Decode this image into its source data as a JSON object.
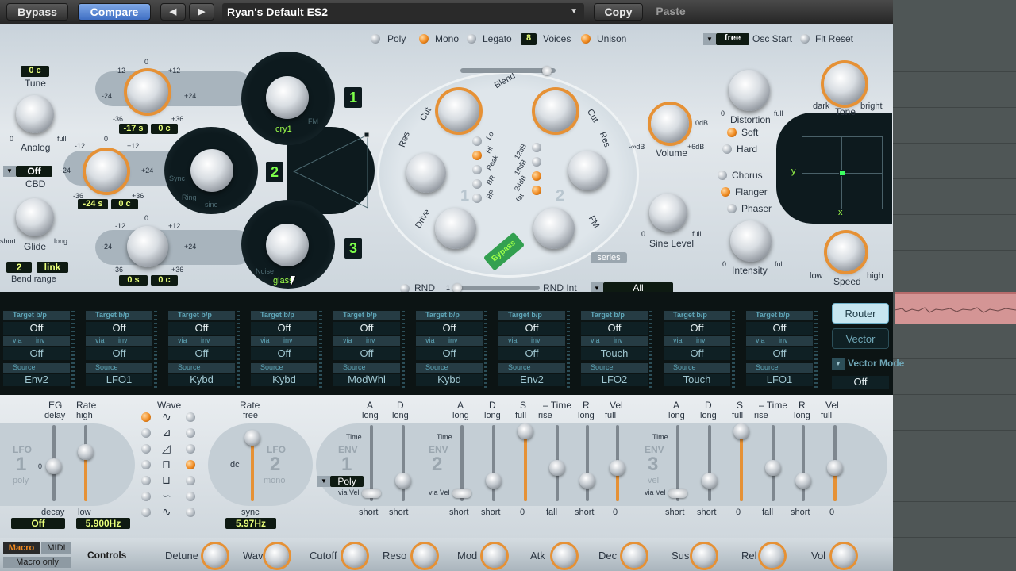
{
  "toolbar": {
    "bypass": "Bypass",
    "compare": "Compare",
    "prev": "◀",
    "next": "▶",
    "preset": "Ryan's Default ES2",
    "copy": "Copy",
    "paste": "Paste"
  },
  "voice": {
    "poly": "Poly",
    "mono": "Mono",
    "legato": "Legato",
    "voices": "8",
    "voices_label": "Voices",
    "unison": "Unison"
  },
  "osc_start": {
    "value": "free",
    "label": "Osc Start",
    "flt_reset": "Flt Reset"
  },
  "left": {
    "tune_value": "0 c",
    "tune": "Tune",
    "analog": "Analog",
    "full": "full",
    "zero": "0",
    "cbd_value": "Off",
    "cbd": "CBD",
    "glide": "Glide",
    "short": "short",
    "long": "long",
    "bend_value": "2",
    "bend_link": "link",
    "bend": "Bend range"
  },
  "osc": {
    "o1_plus": "+12",
    "o1_minus": "-12",
    "o1_p24": "+24",
    "o1_m24": "-24",
    "o1_p36": "+36",
    "o1_m36": "-36",
    "o1_zero": "0",
    "o1_lcd_a": "-17 s",
    "o1_lcd_b": "0 c",
    "o1_wave": "cry1",
    "o1_num": "1",
    "o1_fm": "FM",
    "o2_lcd_a": "-24 s",
    "o2_lcd_b": "0 c",
    "o2_wave": "sine",
    "o2_num": "2",
    "o2_sync": "Sync",
    "o2_ring": "Ring",
    "o3_lcd_a": "0 s",
    "o3_lcd_b": "0 c",
    "o3_wave": "glass",
    "o3_num": "3",
    "o3_noise": "Noise"
  },
  "filter": {
    "blend": "Blend",
    "cut1": "Cut",
    "res1": "Res",
    "drive": "Drive",
    "lo": "Lo",
    "hi": "Hi",
    "peak": "Peak",
    "br": "BR",
    "bp": "BP",
    "db12": "12dB",
    "db18": "18dB",
    "db24": "24dB",
    "fat": "fat",
    "cut2": "Cut",
    "res2": "Res",
    "fm": "FM",
    "series": "series",
    "bypass": "Bypass",
    "n1": "1",
    "n2": "2"
  },
  "rnd": {
    "label": "RND",
    "one": "1",
    "int": "RND Int",
    "value": "All"
  },
  "out": {
    "volume": "Volume",
    "minus_db": "-∞dB",
    "zero_db": "0dB",
    "plus6": "+6dB",
    "distortion": "Distortion",
    "soft": "Soft",
    "hard": "Hard",
    "tone": "Tone",
    "dark": "dark",
    "bright": "bright",
    "sine_level": "Sine Level",
    "full": "full",
    "chorus": "Chorus",
    "flanger": "Flanger",
    "phaser": "Phaser",
    "intensity": "Intensity",
    "speed": "Speed",
    "low": "low",
    "high": "high",
    "zero": "0",
    "x": "x",
    "y": "y"
  },
  "router": {
    "slots": [
      {
        "target": "Target",
        "bp": "b/p",
        "tval": "Off",
        "via": "via",
        "inv": "inv",
        "vval": "Off",
        "source": "Source",
        "sval": "Env2"
      },
      {
        "target": "Target",
        "bp": "b/p",
        "tval": "Off",
        "via": "via",
        "inv": "inv",
        "vval": "Off",
        "source": "Source",
        "sval": "LFO1"
      },
      {
        "target": "Target",
        "bp": "b/p",
        "tval": "Off",
        "via": "via",
        "inv": "inv",
        "vval": "Off",
        "source": "Source",
        "sval": "Kybd"
      },
      {
        "target": "Target",
        "bp": "b/p",
        "tval": "Off",
        "via": "via",
        "inv": "inv",
        "vval": "Off",
        "source": "Source",
        "sval": "Kybd"
      },
      {
        "target": "Target",
        "bp": "b/p",
        "tval": "Off",
        "via": "via",
        "inv": "inv",
        "vval": "Off",
        "source": "Source",
        "sval": "ModWhl"
      },
      {
        "target": "Target",
        "bp": "b/p",
        "tval": "Off",
        "via": "via",
        "inv": "inv",
        "vval": "Off",
        "source": "Source",
        "sval": "Kybd"
      },
      {
        "target": "Target",
        "bp": "b/p",
        "tval": "Off",
        "via": "via",
        "inv": "inv",
        "vval": "Off",
        "source": "Source",
        "sval": "Env2"
      },
      {
        "target": "Target",
        "bp": "b/p",
        "tval": "Off",
        "via": "via",
        "inv": "inv",
        "vval": "Touch",
        "source": "Source",
        "sval": "LFO2"
      },
      {
        "target": "Target",
        "bp": "b/p",
        "tval": "Off",
        "via": "via",
        "inv": "inv",
        "vval": "Off",
        "source": "Source",
        "sval": "Touch"
      },
      {
        "target": "Target",
        "bp": "b/p",
        "tval": "Off",
        "via": "via",
        "inv": "inv",
        "vval": "Off",
        "source": "Source",
        "sval": "LFO1"
      }
    ],
    "router_btn": "Router",
    "vector_btn": "Vector",
    "vector_mode": "Vector Mode",
    "vector_mode_val": "Off"
  },
  "lfo1": {
    "eg": "EG",
    "delay": "delay",
    "decay": "decay",
    "rate": "Rate",
    "high": "high",
    "low": "low",
    "wave": "Wave",
    "title": "LFO",
    "num": "1",
    "poly": "poly",
    "eg_val": "Off",
    "rate_val": "5.900Hz",
    "zero": "0"
  },
  "lfo2": {
    "rate": "Rate",
    "free": "free",
    "sync": "sync",
    "dc": "dc",
    "title": "LFO",
    "num": "2",
    "mono": "mono",
    "rate_val": "5.97Hz"
  },
  "env": {
    "a": "A",
    "d": "D",
    "s": "S",
    "r": "R",
    "vel": "Vel",
    "time": "Time",
    "long": "long",
    "short": "short",
    "full": "full",
    "rise": "rise",
    "fall": "fall",
    "zero": "0",
    "env": "ENV",
    "n1": "1",
    "n2": "2",
    "n3": "3",
    "poly": "Poly",
    "vel_lbl": "vel",
    "via_vel": "via Vel",
    "dash_time": "– Time"
  },
  "macro": {
    "macro": "Macro",
    "midi": "MIDI",
    "macro_only": "Macro only",
    "controls": "Controls",
    "knobs": [
      "Detune",
      "Wave",
      "Cutoff",
      "Reso",
      "Mod",
      "Atk",
      "Dec",
      "Sus",
      "Rel",
      "Vol"
    ]
  }
}
